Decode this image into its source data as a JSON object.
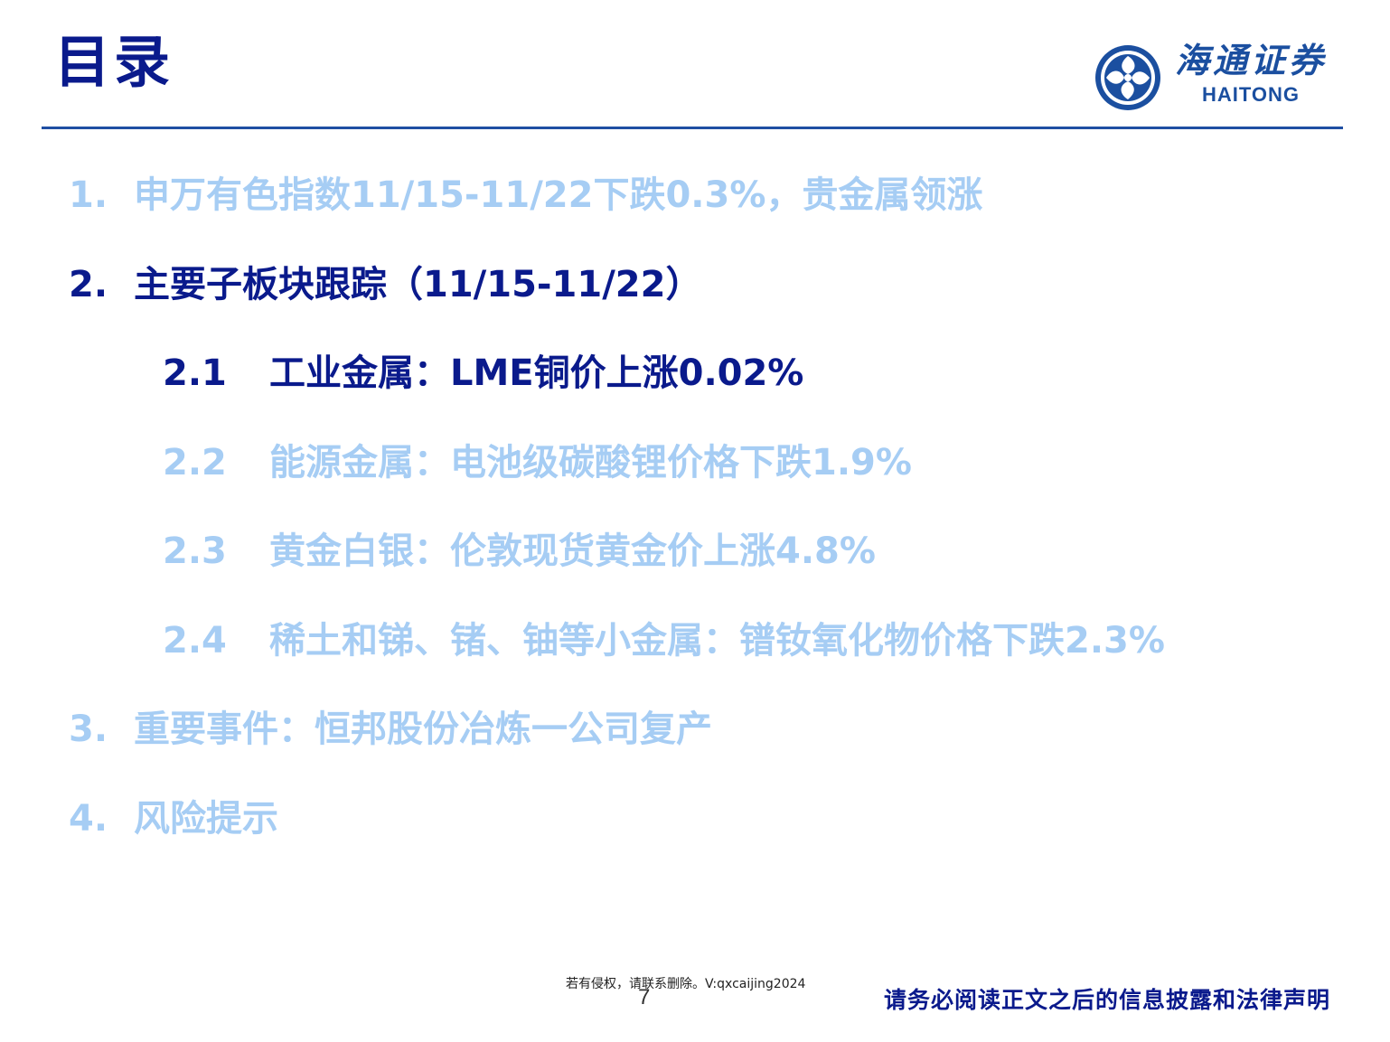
{
  "header": {
    "title": "目录"
  },
  "logo": {
    "name_cn": "海通证券",
    "name_en": "HAITONG",
    "color": "#1b4fa0"
  },
  "toc": {
    "items": [
      {
        "num": "1.",
        "text": "申万有色指数11/15-11/22下跌0.3%，贵金属领涨",
        "active": false
      },
      {
        "num": "2.",
        "text": "主要子板块跟踪（11/15-11/22）",
        "active": true
      },
      {
        "num": "2.1",
        "text": "工业金属：LME铜价上涨0.02%",
        "active": true
      },
      {
        "num": "2.2",
        "text": "能源金属：电池级碳酸锂价格下跌1.9%",
        "active": false
      },
      {
        "num": "2.3",
        "text": "黄金白银：伦敦现货黄金价上涨4.8%",
        "active": false
      },
      {
        "num": "2.4",
        "text": "稀土和锑、锗、铀等小金属：镨钕氧化物价格下跌2.3%",
        "active": false
      },
      {
        "num": "3.",
        "text": "重要事件：恒邦股份冶炼一公司复产",
        "active": false
      },
      {
        "num": "4.",
        "text": "风险提示",
        "active": false
      }
    ]
  },
  "footer": {
    "watermark": "若有侵权，请联系删除。V:qxcaijing2024",
    "page_number": "7",
    "disclaimer": "请务必阅读正文之后的信息披露和法律声明"
  },
  "colors": {
    "active": "#0a1a8c",
    "inactive": "#a6cdf4",
    "rule": "#1f4fa3"
  }
}
